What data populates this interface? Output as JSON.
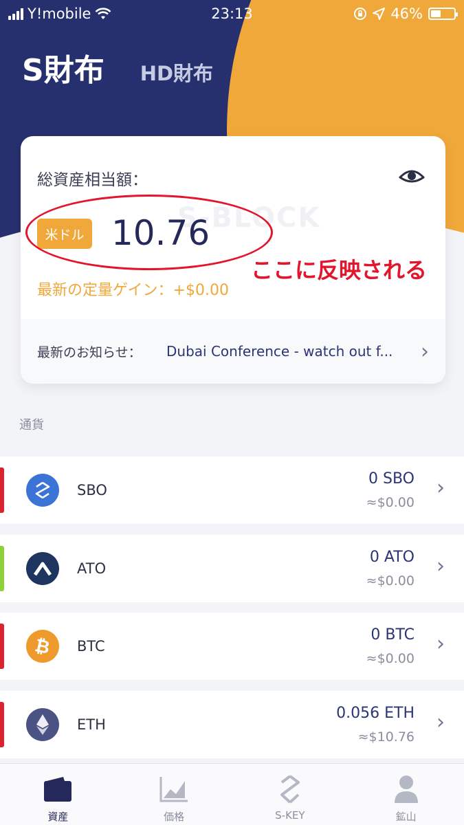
{
  "status_bar": {
    "carrier": "Y!mobile",
    "time": "23:13",
    "battery": "46%",
    "battery_level": 0.46
  },
  "wallet_tabs": {
    "active": "S財布",
    "inactive": "HD財布"
  },
  "asset_card": {
    "label": "総資産相当額：",
    "currency_badge": "米ドル",
    "total_value": "10.76",
    "gain": "最新の定量ゲイン：+$0.00",
    "watermark": "S-BLOCK",
    "news_label": "最新のお知らせ：",
    "news_text": "Dubai Conference - watch out f..."
  },
  "annotation": {
    "text": "ここに反映される"
  },
  "section_title": "通貨",
  "coins": [
    {
      "name": "SBO",
      "amount": "0 SBO",
      "fiat": "≈$0.00",
      "stripe_color": "#d9232e",
      "icon_color": "#3b73d6"
    },
    {
      "name": "ATO",
      "amount": "0 ATO",
      "fiat": "≈$0.00",
      "stripe_color": "#8fd13a",
      "icon_color": "#1e3560"
    },
    {
      "name": "BTC",
      "amount": "0 BTC",
      "fiat": "≈$0.00",
      "stripe_color": "#d9232e",
      "icon_color": "#ef9a2c"
    },
    {
      "name": "ETH",
      "amount": "0.056 ETH",
      "fiat": "≈$10.76",
      "stripe_color": "#d9232e",
      "icon_color": "#4a5384"
    }
  ],
  "bottom_nav": [
    {
      "label": "資産",
      "icon": "wallet-icon"
    },
    {
      "label": "価格",
      "icon": "chart-icon"
    },
    {
      "label": "S-KEY",
      "icon": "skey-icon"
    },
    {
      "label": "鉱山",
      "icon": "user-icon"
    }
  ],
  "colors": {
    "navy": "#27306e",
    "orange": "#f1a83a",
    "annotation_red": "#e3152d"
  }
}
